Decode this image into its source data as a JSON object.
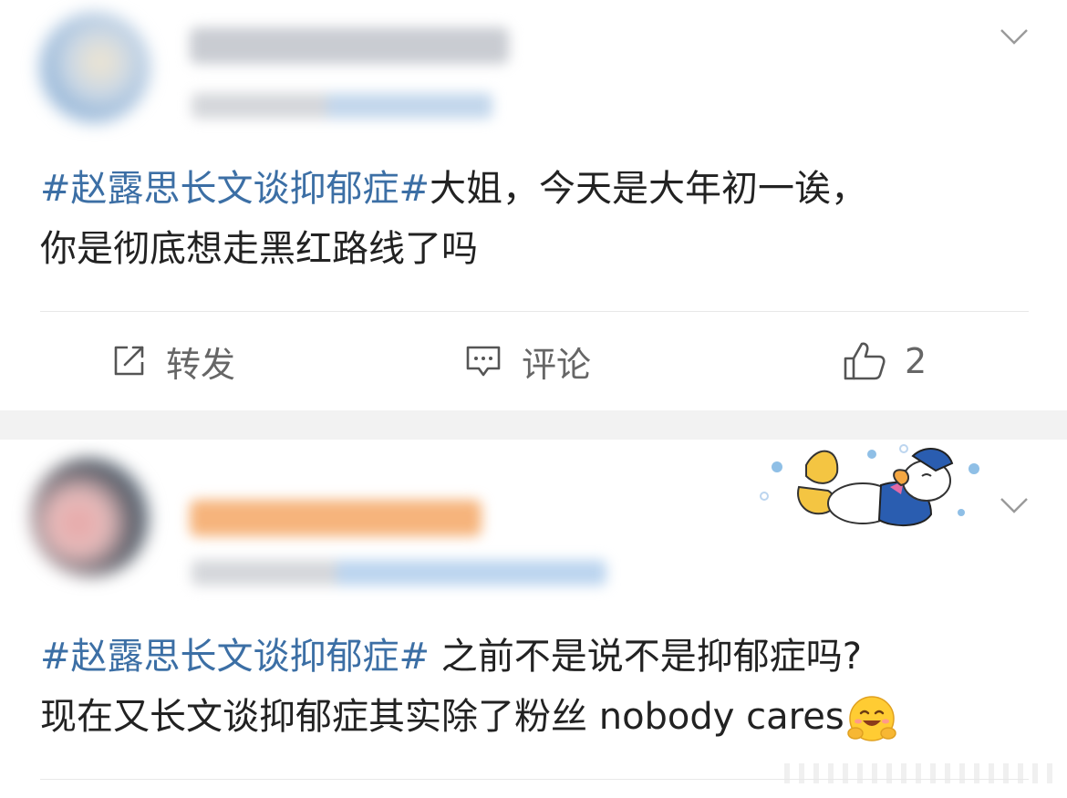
{
  "posts": [
    {
      "content": {
        "hashtag": "#赵露思长文谈抑郁症#",
        "line1_rest": "大姐，今天是大年初一诶，",
        "line2": "你是彻底想走黑红路线了吗"
      },
      "actions": {
        "repost_label": "转发",
        "comment_label": "评论",
        "like_count": "2"
      },
      "icons": [
        "avatar-blurred",
        "chevron-down-icon",
        "repost-icon",
        "comment-icon",
        "thumbs-up-icon"
      ]
    },
    {
      "content": {
        "hashtag": "#赵露思长文谈抑郁症#",
        "line1_rest": " 之前不是说不是抑郁症吗?",
        "line2": "现在又长文谈抑郁症其实除了粉丝 nobody cares"
      },
      "icons": [
        "avatar-blurred",
        "chevron-down-icon",
        "donald-duck-sticker",
        "hugging-emoji-icon"
      ]
    }
  ],
  "colors": {
    "hashtag": "#3c6fa5",
    "text": "#222222",
    "action_text": "#666666",
    "separator": "#f2f2f2"
  }
}
